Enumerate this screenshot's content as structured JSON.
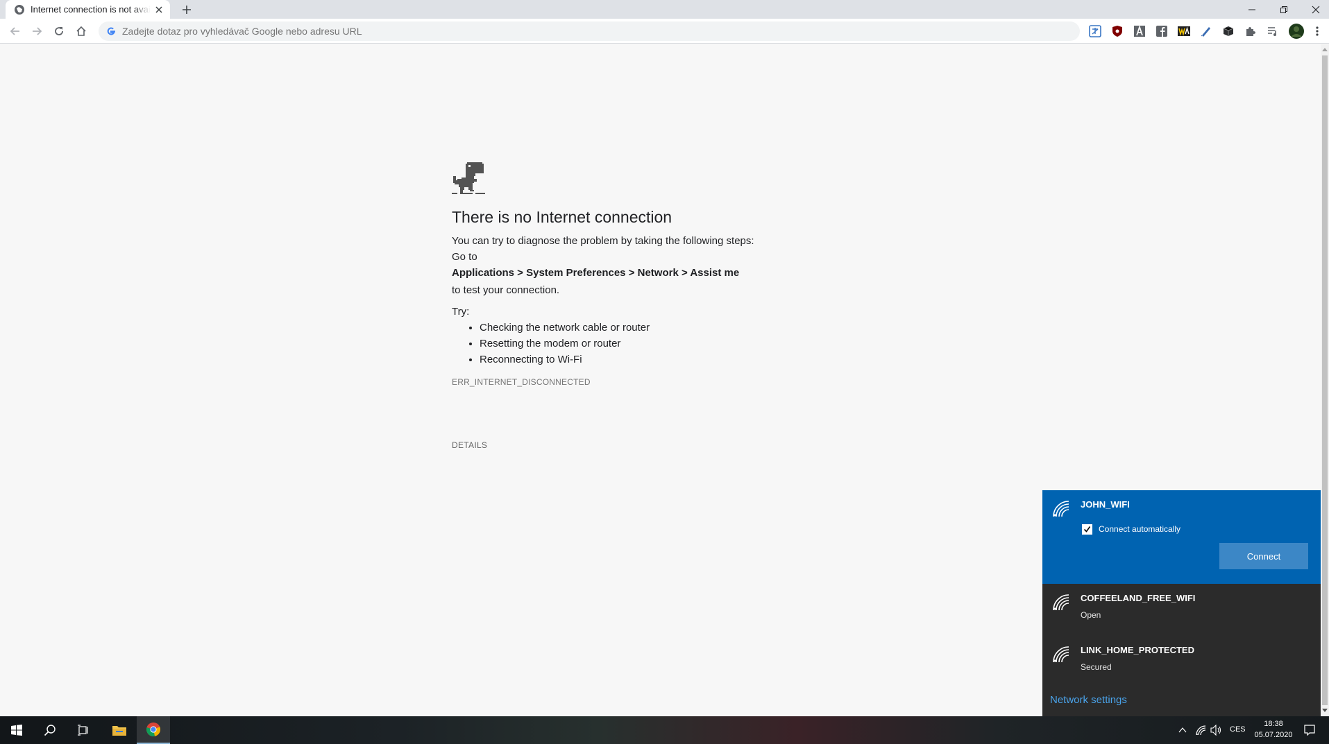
{
  "tab": {
    "title": "Internet connection is not available"
  },
  "toolbar": {
    "omnibox_placeholder": "Zadejte dotaz pro vyhledávač Google nebo adresu URL"
  },
  "error": {
    "heading": "There is no Internet connection",
    "intro": "You can try to diagnose the problem by taking the following steps:",
    "goto": "Go to",
    "path": "Applications > System Preferences > Network > Assist me",
    "test": "to test your connection.",
    "try_label": "Try:",
    "suggestions": [
      "Checking the network cable or router",
      "Resetting the modem or router",
      "Reconnecting to Wi-Fi"
    ],
    "code": "ERR_INTERNET_DISCONNECTED",
    "details": "DETAILS"
  },
  "network_flyout": {
    "networks": [
      {
        "name": "JOHN_WIFI",
        "status": ""
      },
      {
        "name": "COFFEELAND_FREE_WIFI",
        "status": "Open"
      },
      {
        "name": "LINK_HOME_PROTECTED",
        "status": "Secured"
      }
    ],
    "auto_connect_label": "Connect automatically",
    "auto_connect_checked": true,
    "connect_button": "Connect",
    "settings_link": "Network settings"
  },
  "taskbar": {
    "language": "CES",
    "time": "18:38",
    "date": "05.07.2020"
  },
  "colors": {
    "flyout_active": "#0063b1",
    "flyout_bg": "#2b2b2b",
    "connect_button": "#3c87c6",
    "link": "#4aa3ea",
    "page_bg": "#f7f7f7"
  }
}
